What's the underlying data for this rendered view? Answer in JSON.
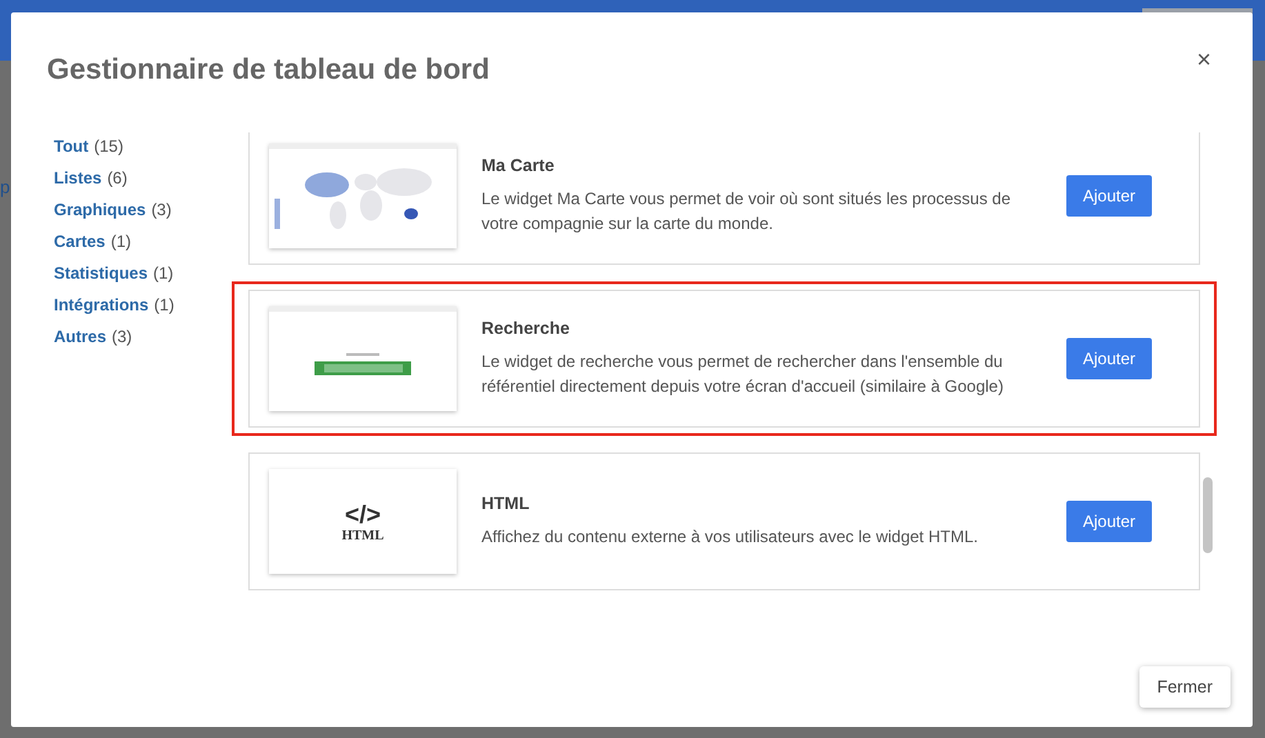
{
  "background": {
    "fragment": "p"
  },
  "dialog": {
    "title": "Gestionnaire de tableau de bord",
    "close": "×"
  },
  "categories": [
    {
      "label": "Tout",
      "count": "(15)"
    },
    {
      "label": "Listes",
      "count": "(6)"
    },
    {
      "label": "Graphiques",
      "count": "(3)"
    },
    {
      "label": "Cartes",
      "count": "(1)"
    },
    {
      "label": "Statistiques",
      "count": "(1)"
    },
    {
      "label": "Intégrations",
      "count": "(1)"
    },
    {
      "label": "Autres",
      "count": "(3)"
    }
  ],
  "widgets": [
    {
      "kind": "map",
      "title": "Ma Carte",
      "description": "Le widget Ma Carte vous permet de voir où sont situés les processus de votre compagnie sur la carte du monde.",
      "button": "Ajouter",
      "highlighted": false
    },
    {
      "kind": "search",
      "title": "Recherche",
      "description": "Le widget de recherche vous permet de rechercher dans l'ensemble du référentiel directement depuis votre écran d'accueil (similaire à Google)",
      "button": "Ajouter",
      "highlighted": true
    },
    {
      "kind": "html",
      "title": "HTML",
      "description": "Affichez du contenu externe à vos utilisateurs avec le widget HTML.",
      "button": "Ajouter",
      "highlighted": false,
      "thumb_code": "</>",
      "thumb_label": "HTML"
    }
  ],
  "footer": {
    "button": "Fermer"
  }
}
